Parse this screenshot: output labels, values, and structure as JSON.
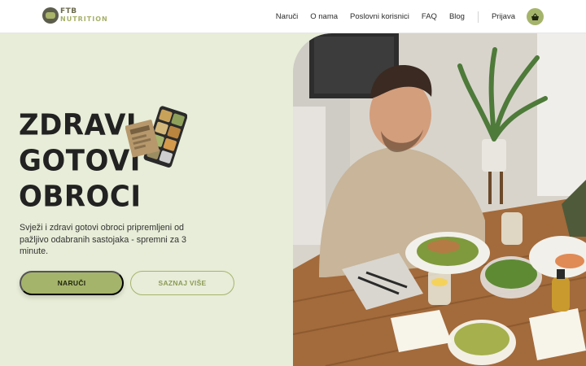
{
  "brand": {
    "line1": "FTB",
    "line2": "NUTRITION"
  },
  "nav": {
    "items": [
      "Naruči",
      "O nama",
      "Poslovni korisnici",
      "FAQ",
      "Blog"
    ],
    "login": "Prijava",
    "cart_icon": "basket-icon"
  },
  "hero": {
    "title_lines": [
      "ZDRAVI",
      "GOTOVI",
      "OBROCI"
    ],
    "description": "Svježi i zdravi gotovi obroci pripremljeni od pažljivo odabranih sastojaka - spremni za 3 minute.",
    "primary_button": "NARUČI",
    "secondary_button": "SAZNAJ VIŠE"
  },
  "colors": {
    "accent": "#a5b46b",
    "background": "#e7edd8",
    "text": "#222222"
  }
}
